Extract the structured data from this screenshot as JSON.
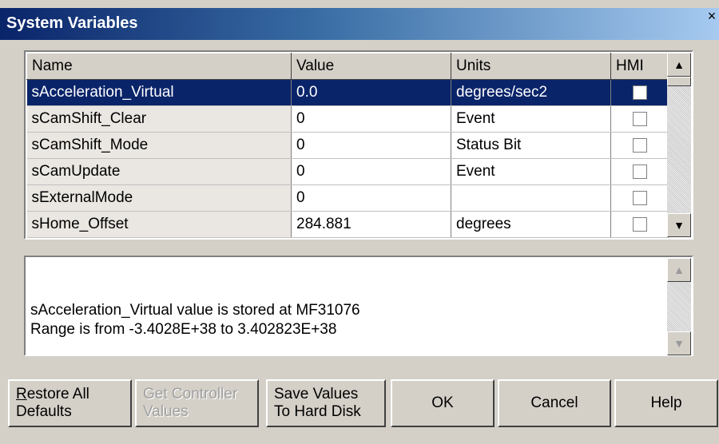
{
  "window": {
    "title": "System Variables",
    "close_glyph": "×"
  },
  "grid": {
    "columns": [
      "Name",
      "Value",
      "Units",
      "HMI"
    ],
    "rows": [
      {
        "name": "sAcceleration_Virtual",
        "value": "0.0",
        "units": "degrees/sec2",
        "hmi": false,
        "selected": true
      },
      {
        "name": "sCamShift_Clear",
        "value": "0",
        "units": "Event",
        "hmi": false
      },
      {
        "name": "sCamShift_Mode",
        "value": "0",
        "units": "Status Bit",
        "hmi": false
      },
      {
        "name": "sCamUpdate",
        "value": "0",
        "units": "Event",
        "hmi": false
      },
      {
        "name": "sExternalMode",
        "value": "0",
        "units": "",
        "hmi": false
      },
      {
        "name": "sHome_Offset",
        "value": "284.881",
        "units": "degrees",
        "hmi": false
      }
    ]
  },
  "scroll": {
    "up": "▲",
    "down": "▼"
  },
  "description": {
    "line1": "sAcceleration_Virtual value is stored at MF31076",
    "line2": "Range is from -3.4028E+38 to 3.402823E+38"
  },
  "buttons": {
    "restore": {
      "line1": "Restore All",
      "line2": "Defaults"
    },
    "get_controller": {
      "line1": "Get Controller",
      "line2": "Values"
    },
    "save": {
      "line1": "Save Values",
      "line2": "To Hard Disk"
    },
    "ok": "OK",
    "cancel": "Cancel",
    "help": "Help"
  }
}
